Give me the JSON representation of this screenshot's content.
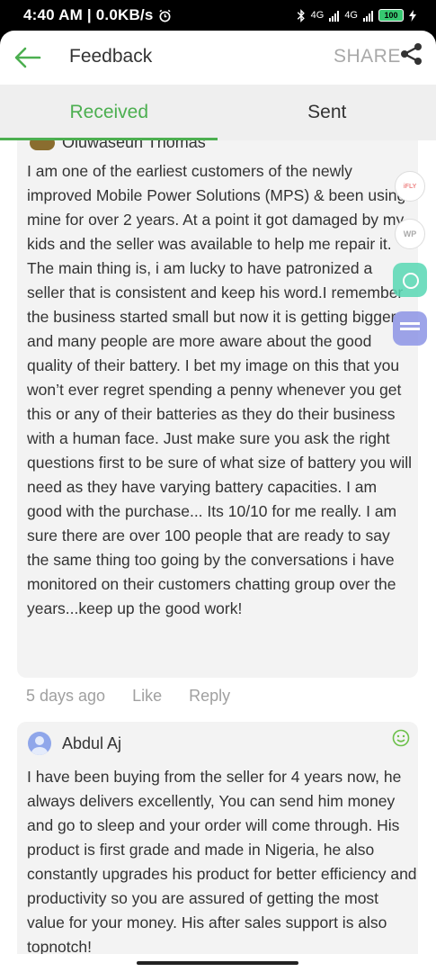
{
  "status_bar": {
    "time_speed": "4:40 AM | 0.0KB/s",
    "network_1": "4G",
    "network_2": "4G",
    "battery": "100"
  },
  "header": {
    "title": "Feedback",
    "share_label": "SHARE",
    "accent_color": "#4caf50"
  },
  "tabs": [
    {
      "label": "Received",
      "active": true
    },
    {
      "label": "Sent",
      "active": false
    }
  ],
  "reviews": [
    {
      "author": "Oluwaseun Thomas",
      "text": "I am one of the earliest customers of the newly improved Mobile Power Solutions (MPS) & been using mine for over 2 years. At a point it got damaged by my kids and the seller was available to help me repair it. The main thing is, i am lucky to have patronized a seller that is consistent and keep his word.I remember the business started small but now it is getting bigger and many people are more aware about the good quality of their battery. I bet my image on this that you won’t ever regret spending a penny whenever you get this or any of their batteries as they do their business with a human face. Just make sure you ask the right questions first to be sure of what size of battery you will need as they have varying battery capacities. I am good with the purchase... Its 10/10 for me really. I am sure there are over 100 people that are ready to say the same thing too going by the conversations i have monitored on their customers chatting group over the years...keep up the good work!",
      "time": "5 days ago",
      "like_label": "Like",
      "reply_label": "Reply"
    },
    {
      "author": "Abdul Aj",
      "text": "I have been buying from the seller for 4 years now, he always delivers excellently, You can send him money and go to sleep and your order will come through. His product is first grade and made in Nigeria, he also constantly upgrades his product for better efficiency and productivity so you are assured of getting the most value for your money. His after sales support is also topnotch!"
    }
  ],
  "floating_icons": {
    "ifly_label": "iFLY",
    "wp_label": "WP"
  },
  "icons": [
    "back-arrow-icon",
    "share-icon",
    "smile-icon",
    "bluetooth-icon",
    "alarm-icon"
  ]
}
